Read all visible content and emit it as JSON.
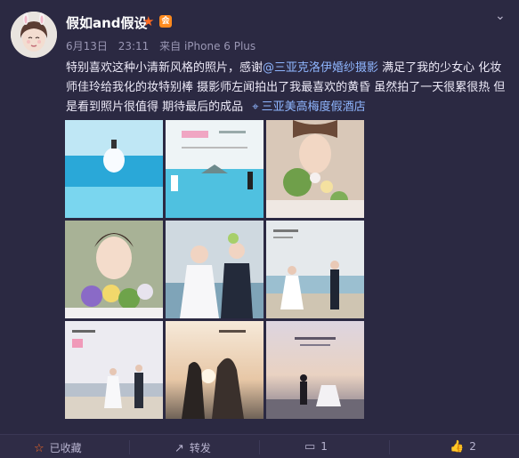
{
  "header": {
    "username": "假如and假设",
    "star": "★",
    "vip": "会",
    "chevron": "⌄",
    "date": "6月13日",
    "time": "23:11",
    "source": "来自 iPhone 6 Plus"
  },
  "post": {
    "text_before_mention": "特别喜欢这种小清新风格的照片，感谢",
    "mention": "@三亚克洛伊婚纱摄影",
    "text_after_mention": " 满足了我的少女心 化妆师佳玲给我化的妆特别棒 摄影师左闻拍出了我最喜欢的黄昏 虽然拍了一天很累很热 但是看到照片很值得 期待最后的成品",
    "location_icon": "⌖",
    "location": "三亚美高梅度假酒店"
  },
  "footer": {
    "favorite_icon": "☆",
    "favorite_label": "已收藏",
    "repost_icon": "↗",
    "repost_label": "转发",
    "comment_icon": "▭",
    "comment_count": "1",
    "like_icon": "👍",
    "like_count": "2"
  },
  "colors": {
    "background": "#2b2942",
    "link": "#8fb6ff",
    "star": "#ff6a21"
  }
}
